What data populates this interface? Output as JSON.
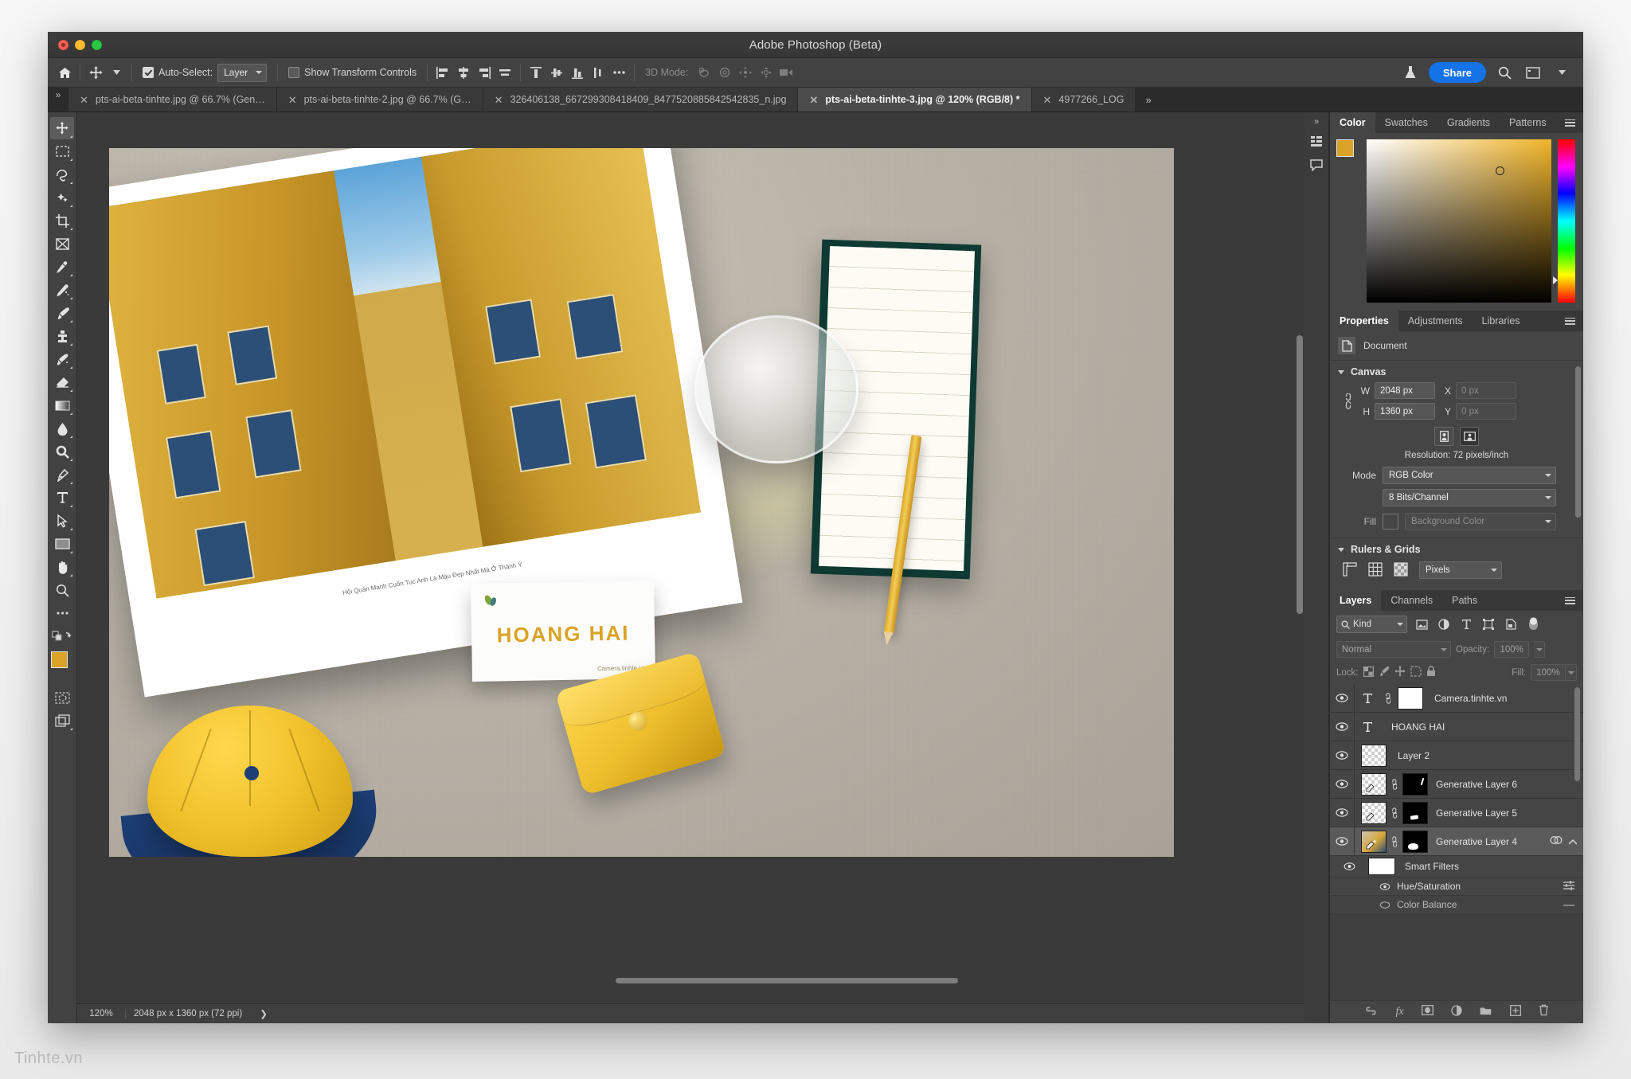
{
  "window": {
    "title": "Adobe Photoshop (Beta)"
  },
  "options_bar": {
    "home_icon": "home-icon",
    "tool_icon": "move-tool-icon",
    "auto_select_label": "Auto-Select:",
    "auto_select_checked": true,
    "auto_select_value": "Layer",
    "show_transform_label": "Show Transform Controls",
    "show_transform_checked": false,
    "align_icons": [
      "align-left-edges-icon",
      "align-horizontal-centers-icon",
      "align-right-edges-icon",
      "distribute-horizontal-icon"
    ],
    "align_icons2": [
      "align-top-edges-icon",
      "align-vertical-centers-icon",
      "align-bottom-edges-icon",
      "distribute-vertical-icon"
    ],
    "more_label": "•••",
    "mode_3d_label": "3D Mode:",
    "mode_3d_icons": [
      "orbit-3d-icon",
      "roll-3d-icon",
      "pan-3d-icon",
      "slide-3d-icon",
      "zoom-3d-camera-icon"
    ],
    "lab_icon": "flask-icon",
    "share_label": "Share",
    "search_icon": "search-icon",
    "workspace_icon": "workspace-panel-icon"
  },
  "tabs": [
    {
      "label": "pts-ai-beta-tinhte.jpg @ 66.7% (Gen…",
      "active": false
    },
    {
      "label": "pts-ai-beta-tinhte-2.jpg @ 66.7% (G…",
      "active": false
    },
    {
      "label": "326406138_667299308418409_8477520885842542835_n.jpg",
      "active": false
    },
    {
      "label": "pts-ai-beta-tinhte-3.jpg @ 120% (RGB/8) *",
      "active": true
    },
    {
      "label": "4977266_LOG",
      "active": false
    }
  ],
  "tabs_overflow": "»",
  "toolbox": [
    {
      "name": "move-tool-icon",
      "selected": true
    },
    {
      "name": "rectangular-marquee-tool-icon",
      "selected": false
    },
    {
      "name": "lasso-tool-icon",
      "selected": false
    },
    {
      "name": "object-selection-tool-icon",
      "selected": false
    },
    {
      "name": "crop-tool-icon",
      "selected": false
    },
    {
      "name": "frame-tool-icon",
      "selected": false
    },
    {
      "name": "eyedropper-tool-icon",
      "selected": false
    },
    {
      "name": "spot-healing-brush-tool-icon",
      "selected": false
    },
    {
      "name": "brush-tool-icon",
      "selected": false
    },
    {
      "name": "clone-stamp-tool-icon",
      "selected": false
    },
    {
      "name": "history-brush-tool-icon",
      "selected": false
    },
    {
      "name": "eraser-tool-icon",
      "selected": false
    },
    {
      "name": "gradient-tool-icon",
      "selected": false
    },
    {
      "name": "blur-tool-icon",
      "selected": false
    },
    {
      "name": "dodge-tool-icon",
      "selected": false
    },
    {
      "name": "pen-tool-icon",
      "selected": false
    },
    {
      "name": "type-tool-icon",
      "selected": false
    },
    {
      "name": "path-selection-tool-icon",
      "selected": false
    },
    {
      "name": "rectangle-tool-icon",
      "selected": false
    },
    {
      "name": "hand-tool-icon",
      "selected": false
    },
    {
      "name": "zoom-tool-icon",
      "selected": false
    },
    {
      "name": "edit-toolbar-icon",
      "selected": false
    },
    {
      "name": "default-colors-icon",
      "selected": false
    },
    {
      "name": "quick-mask-icon",
      "selected": false
    },
    {
      "name": "screen-mode-icon",
      "selected": false
    }
  ],
  "canvas": {
    "card_name": "HOANG HAI",
    "card_sub": "Camera.tinhte.vn",
    "magazine_caption": "Hội Quán Manh Cuốn Tuc Anh Là Màu Đẹp Nhất Mà Ở Thành Ý"
  },
  "status_bar": {
    "zoom": "120%",
    "dimensions": "2048 px x 1360 px (72 ppi)",
    "expander": "❯"
  },
  "color_panel": {
    "tabs": [
      {
        "label": "Color",
        "active": true
      },
      {
        "label": "Swatches",
        "active": false
      },
      {
        "label": "Gradients",
        "active": false
      },
      {
        "label": "Patterns",
        "active": false
      }
    ],
    "foreground": "#d9a328",
    "background": "#efefef",
    "menu_icon": "panel-menu-icon"
  },
  "properties_panel": {
    "tabs": [
      {
        "label": "Properties",
        "active": true
      },
      {
        "label": "Adjustments",
        "active": false
      },
      {
        "label": "Libraries",
        "active": false
      }
    ],
    "menu_icon": "panel-menu-icon",
    "document_label": "Document",
    "document_icon": "document-icon",
    "canvas_section": "Canvas",
    "w_label": "W",
    "w_value": "2048 px",
    "h_label": "H",
    "h_value": "1360 px",
    "x_label": "X",
    "x_value": "0 px",
    "y_label": "Y",
    "y_value": "0 px",
    "link_icon": "link-dimensions-icon",
    "orientation_portrait_icon": "portrait-orientation-icon",
    "orientation_landscape_icon": "landscape-orientation-icon",
    "resolution": "Resolution: 72 pixels/inch",
    "mode_label": "Mode",
    "mode_value": "RGB Color",
    "depth_value": "8 Bits/Channel",
    "fill_label": "Fill",
    "fill_value": "Background Color",
    "rulers_section": "Rulers & Grids",
    "ruler_icon": "ruler-icon",
    "grid_icon": "grid-icon",
    "transparency-grid_icon": "transparency-grid-icon",
    "units_value": "Pixels"
  },
  "layers_panel": {
    "tabs": [
      {
        "label": "Layers",
        "active": true
      },
      {
        "label": "Channels",
        "active": false
      },
      {
        "label": "Paths",
        "active": false
      }
    ],
    "menu_icon": "panel-menu-icon",
    "kind_label": "Kind",
    "filter_icons": [
      "filter-pixel-icon",
      "filter-adjustment-icon",
      "filter-type-icon",
      "filter-shape-icon",
      "filter-smartobject-icon",
      "filter-toggle-icon"
    ],
    "blend_mode": "Normal",
    "opacity_label": "Opacity:",
    "opacity_value": "100%",
    "lock_label": "Lock:",
    "lock_icons": [
      "lock-transparent-pixels-icon",
      "lock-image-pixels-icon",
      "lock-position-icon",
      "lock-artboard-icon",
      "lock-all-icon"
    ],
    "fill_label": "Fill:",
    "fill_value": "100%",
    "rows": [
      {
        "name": "Camera.tinhte.vn",
        "type": "text",
        "visible": true,
        "linked": true,
        "mask": "white",
        "selected": false
      },
      {
        "name": "HOANG HAI",
        "type": "text",
        "visible": true,
        "linked": false,
        "mask": "none",
        "selected": false
      },
      {
        "name": "Layer 2",
        "type": "pixel",
        "visible": true,
        "linked": false,
        "mask": "none",
        "selected": false
      },
      {
        "name": "Generative Layer 6",
        "type": "generative",
        "visible": true,
        "linked": true,
        "mask": "black",
        "selected": false
      },
      {
        "name": "Generative Layer 5",
        "type": "generative",
        "visible": true,
        "linked": true,
        "mask": "black",
        "selected": false
      },
      {
        "name": "Generative Layer 4",
        "type": "generative",
        "visible": true,
        "linked": true,
        "mask": "black",
        "selected": true
      }
    ],
    "smart_filters_label": "Smart Filters",
    "filter_rows": [
      "Hue/Saturation",
      "Color Balance"
    ],
    "footer_icons": [
      "link-layers-icon",
      "layer-styles-fx-icon",
      "add-layer-mask-icon",
      "new-fill-adjustment-icon",
      "new-group-icon",
      "new-layer-icon",
      "delete-layer-icon"
    ]
  },
  "dock_icons": [
    "history-panel-icon",
    "comments-panel-icon"
  ],
  "watermark": "Tinhte.vn"
}
